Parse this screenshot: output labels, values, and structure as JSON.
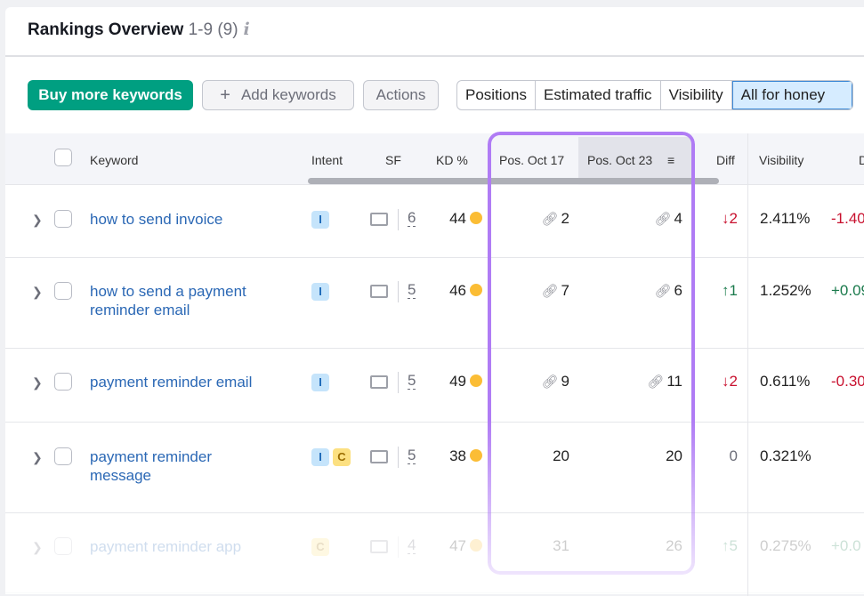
{
  "header": {
    "title": "Rankings Overview",
    "count": "1-9 (9)",
    "info": "i"
  },
  "toolbar": {
    "buy": "Buy more keywords",
    "add": "Add keywords",
    "add_icon": "+",
    "actions": "Actions"
  },
  "tabs": [
    "Positions",
    "Estimated traffic",
    "Visibility",
    "All for honey"
  ],
  "columns": {
    "keyword": "Keyword",
    "intent": "Intent",
    "sf": "SF",
    "kd": "KD %",
    "pos1": "Pos. Oct 17",
    "pos2": "Pos. Oct 23",
    "diff": "Diff",
    "visibility": "Visibility",
    "last": "D"
  },
  "colors": {
    "accent": "#009f81",
    "highlight": "#b07cf5",
    "down": "#c8102e",
    "up": "#1a7a4c"
  },
  "rows": [
    {
      "keyword": "how to send invoice",
      "intents": [
        "I"
      ],
      "sf": "6",
      "kd": "44",
      "pos1": "2",
      "pos2": "4",
      "link1": true,
      "link2": true,
      "diff": "↓2",
      "dir": "down",
      "vis": "2.411%",
      "visdiff": "-1.40"
    },
    {
      "keyword": "how to send a payment reminder email",
      "intents": [
        "I"
      ],
      "sf": "5",
      "kd": "46",
      "pos1": "7",
      "pos2": "6",
      "link1": true,
      "link2": true,
      "diff": "↑1",
      "dir": "up",
      "vis": "1.252%",
      "visdiff": "+0.09"
    },
    {
      "keyword": "payment reminder email",
      "intents": [
        "I"
      ],
      "sf": "5",
      "kd": "49",
      "pos1": "9",
      "pos2": "11",
      "link1": true,
      "link2": true,
      "diff": "↓2",
      "dir": "down",
      "vis": "0.611%",
      "visdiff": "-0.30"
    },
    {
      "keyword": "payment reminder message",
      "intents": [
        "I",
        "C"
      ],
      "sf": "5",
      "kd": "38",
      "pos1": "20",
      "pos2": "20",
      "link1": false,
      "link2": false,
      "diff": "0",
      "dir": "none",
      "vis": "0.321%",
      "visdiff": ""
    },
    {
      "keyword": "payment reminder app",
      "intents": [
        "C"
      ],
      "sf": "4",
      "kd": "47",
      "pos1": "31",
      "pos2": "26",
      "link1": false,
      "link2": false,
      "diff": "↑5",
      "dir": "up",
      "vis": "0.275%",
      "visdiff": "+0.0"
    }
  ]
}
